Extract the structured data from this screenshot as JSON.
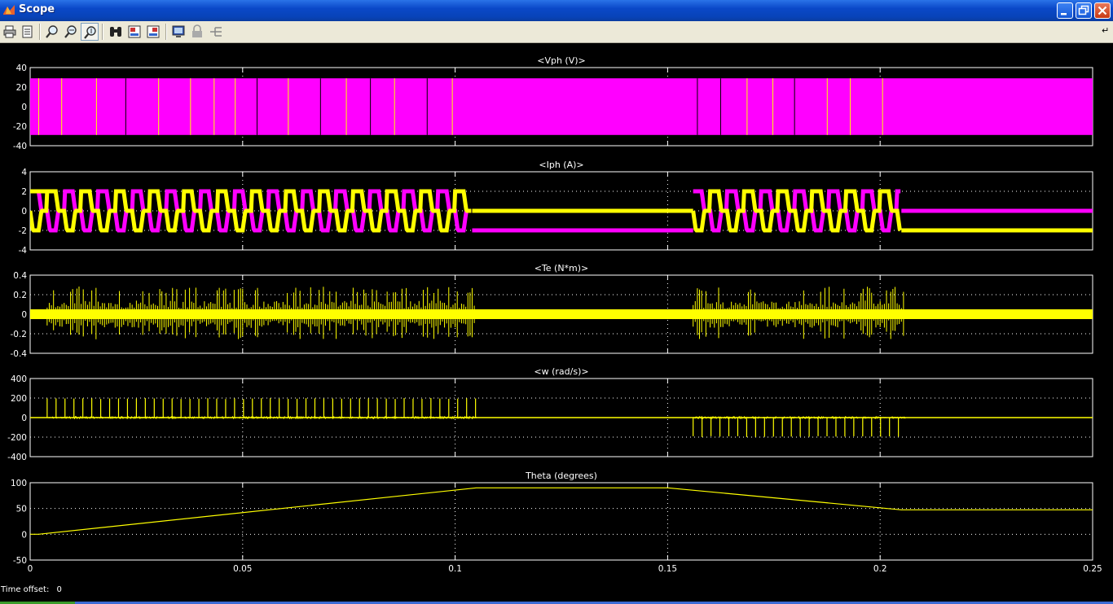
{
  "window": {
    "title": "Scope",
    "icons": [
      "matlab-scope-icon",
      "minimize-icon",
      "maximize-icon",
      "close-icon"
    ]
  },
  "toolbar": {
    "buttons": [
      {
        "name": "print-icon"
      },
      {
        "name": "parameters-icon"
      },
      {
        "name": "zoom-icon"
      },
      {
        "name": "zoom-x-icon"
      },
      {
        "name": "zoom-y-icon",
        "active": true
      },
      {
        "name": "autoscale-binoculars-icon"
      },
      {
        "name": "save-axes-settings-icon"
      },
      {
        "name": "restore-axes-settings-icon"
      },
      {
        "name": "floating-scope-icon"
      },
      {
        "name": "lock-axes-icon"
      },
      {
        "name": "signal-selection-icon"
      }
    ],
    "corner_glyph": "↵"
  },
  "footer": {
    "time_offset_label": "Time offset:",
    "time_offset_value": "0"
  },
  "colors": {
    "background": "#000000",
    "axes_text": "#ffffff",
    "grid": "#ffffff",
    "trace_yellow": "#ffff00",
    "trace_magenta": "#ff00ff"
  },
  "chart_data": [
    {
      "type": "line",
      "title": "<Vph (V)>",
      "x": {
        "lim": [
          0,
          0.25
        ],
        "ticks": [
          0,
          0.05,
          0.1,
          0.15,
          0.2,
          0.25
        ]
      },
      "ylim": [
        -40,
        40
      ],
      "yticks": [
        40,
        20,
        0,
        -20,
        -40
      ],
      "grid": true,
      "series": [
        {
          "color": "#ff00ff",
          "description_level_high": 29,
          "description_level_low": -29,
          "pwm_switching_ranges": [
            [
              0.0,
              0.1035
            ],
            [
              0.155,
              0.2035
            ]
          ]
        }
      ]
    },
    {
      "type": "line",
      "title": "<Iph (A)>",
      "x": {
        "lim": [
          0,
          0.25
        ],
        "ticks": [
          0,
          0.05,
          0.1,
          0.15,
          0.2,
          0.25
        ]
      },
      "ylim": [
        -4,
        4
      ],
      "yticks": [
        4,
        2,
        0,
        -2,
        -4
      ],
      "grid": true,
      "series": [
        {
          "color": "#ffff00",
          "levels": [
            2,
            0,
            -2
          ],
          "active_ranges": [
            [
              0.0,
              0.104
            ],
            [
              0.156,
              0.205
            ]
          ],
          "idle_after_first": 0,
          "idle_after_second": -2
        },
        {
          "color": "#ff00ff",
          "levels": [
            2,
            0,
            -2
          ],
          "active_ranges": [
            [
              0.0,
              0.104
            ],
            [
              0.156,
              0.205
            ]
          ],
          "idle_after_first": -2,
          "idle_after_second": 0
        }
      ]
    },
    {
      "type": "line",
      "title": "<Te (N*m)>",
      "x": {
        "lim": [
          0,
          0.25
        ],
        "ticks": [
          0,
          0.05,
          0.1,
          0.15,
          0.2,
          0.25
        ]
      },
      "ylim": [
        -0.4,
        0.4
      ],
      "yticks": [
        0.4,
        0.2,
        0,
        -0.2,
        -0.4
      ],
      "grid": true,
      "series": [
        {
          "color": "#ffff00",
          "band": [
            -0.05,
            0.05
          ],
          "spike_peak": 0.27,
          "spike_min": -0.27,
          "active_ranges": [
            [
              0.004,
              0.105
            ],
            [
              0.156,
              0.206
            ]
          ]
        }
      ]
    },
    {
      "type": "line",
      "title": "<w (rad/s)>",
      "x": {
        "lim": [
          0,
          0.25
        ],
        "ticks": [
          0,
          0.05,
          0.1,
          0.15,
          0.2,
          0.25
        ]
      },
      "ylim": [
        -400,
        400
      ],
      "yticks": [
        400,
        200,
        0,
        -200,
        -400
      ],
      "grid": true,
      "series": [
        {
          "color": "#ffff00",
          "spike_value_first_range": 200,
          "spike_value_second_range": -200,
          "active_ranges": [
            [
              0.004,
              0.105
            ],
            [
              0.156,
              0.206
            ]
          ]
        }
      ]
    },
    {
      "type": "line",
      "title": "Theta (degrees)",
      "x": {
        "lim": [
          0,
          0.25
        ],
        "ticks": [
          0,
          0.05,
          0.1,
          0.15,
          0.2,
          0.25
        ],
        "ticklabels": [
          "0",
          "0.05",
          "0.1",
          "0.15",
          "0.2",
          "0.25"
        ]
      },
      "ylim": [
        -50,
        100
      ],
      "yticks": [
        100,
        50,
        0,
        -50
      ],
      "grid": true,
      "series": [
        {
          "color": "#ffff00",
          "points": [
            [
              0,
              0
            ],
            [
              0.002,
              0
            ],
            [
              0.105,
              90
            ],
            [
              0.15,
              90
            ],
            [
              0.205,
              47.5
            ],
            [
              0.25,
              47.5
            ]
          ]
        }
      ]
    }
  ]
}
